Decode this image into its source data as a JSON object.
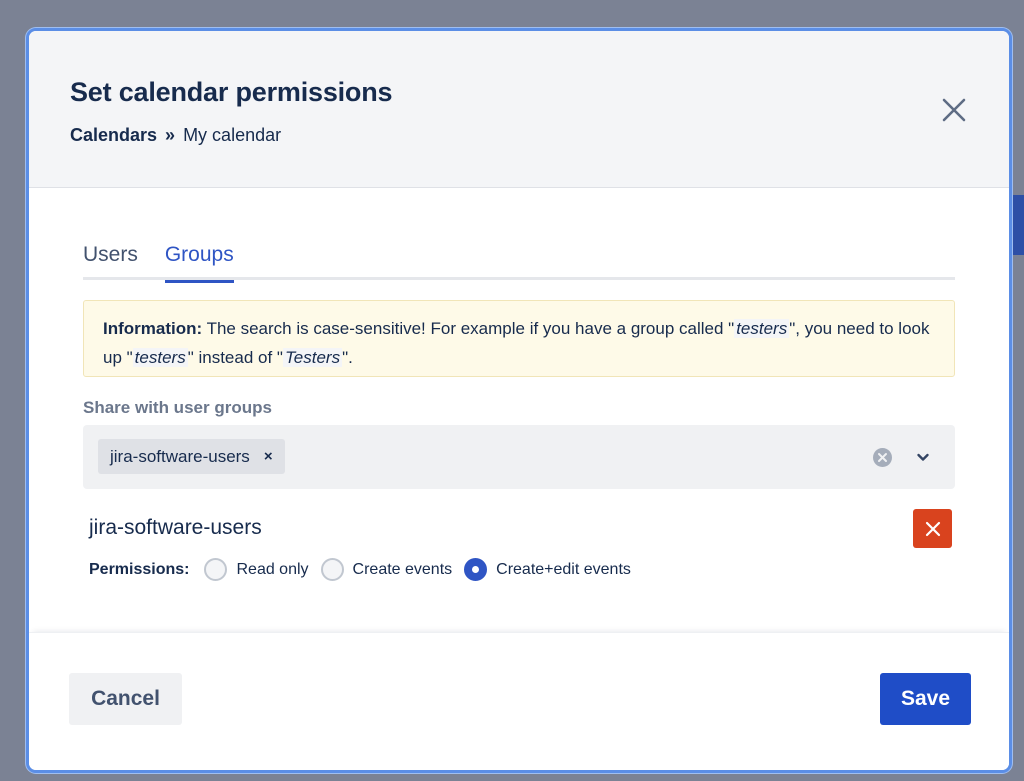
{
  "modal": {
    "title": "Set calendar permissions",
    "breadcrumb": {
      "root": "Calendars",
      "separator": "»",
      "current": "My calendar"
    }
  },
  "tabs": [
    {
      "label": "Users",
      "active": false
    },
    {
      "label": "Groups",
      "active": true
    }
  ],
  "info": {
    "label": "Information:",
    "text_1": " The search is case-sensitive! For example if you have a group called \"",
    "term_1": "testers",
    "text_2": "\", you need to look up \"",
    "term_2": "testers",
    "text_3": "\" instead of \"",
    "term_3": "Testers",
    "text_4": "\"."
  },
  "share": {
    "label": "Share with user groups",
    "selected_chip": "jira-software-users",
    "chip_remove": "×"
  },
  "group_entry": {
    "name": "jira-software-users",
    "permissions_label": "Permissions:",
    "options": [
      {
        "label": "Read only",
        "checked": false
      },
      {
        "label": "Create events",
        "checked": false
      },
      {
        "label": "Create+edit events",
        "checked": true
      }
    ]
  },
  "footer": {
    "cancel_label": "Cancel",
    "save_label": "Save"
  },
  "colors": {
    "primary": "#1f4dc7",
    "tab_active": "#2f55c4",
    "danger": "#d9431e",
    "info_bg": "#fefae8"
  },
  "icons": {
    "close": "close-icon",
    "clear": "clear-circle-icon",
    "dropdown": "chevron-down-icon",
    "delete": "delete-x-icon"
  }
}
